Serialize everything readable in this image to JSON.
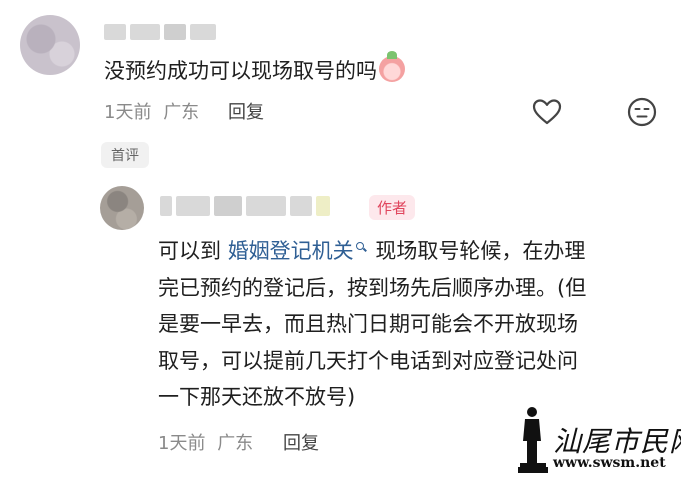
{
  "comment": {
    "text": "没预约成功可以现场取号的吗",
    "time": "1天前",
    "location": "广东",
    "reply_label": "回复",
    "first_badge": "首评"
  },
  "reply": {
    "author_badge": "作者",
    "line1_pre": "可以到 ",
    "link_text": "婚姻登记机关",
    "line1_post": " 现场取号轮候，在办理",
    "line2": "完已预约的登记后，按到场先后顺序办理。(但",
    "line3": "是要一早去，而且热门日期可能会不开放现场",
    "line4": "取号，可以提前几天打个电话到对应登记处问",
    "line5": "一下那天还放不放号)",
    "time": "1天前",
    "location": "广东",
    "reply_label": "回复"
  },
  "watermark": {
    "title": "汕尾市民网",
    "url": "www.swsm.net"
  },
  "icons": {
    "like": "heart-icon",
    "dislike": "neutral-face-icon",
    "search": "search-icon"
  }
}
